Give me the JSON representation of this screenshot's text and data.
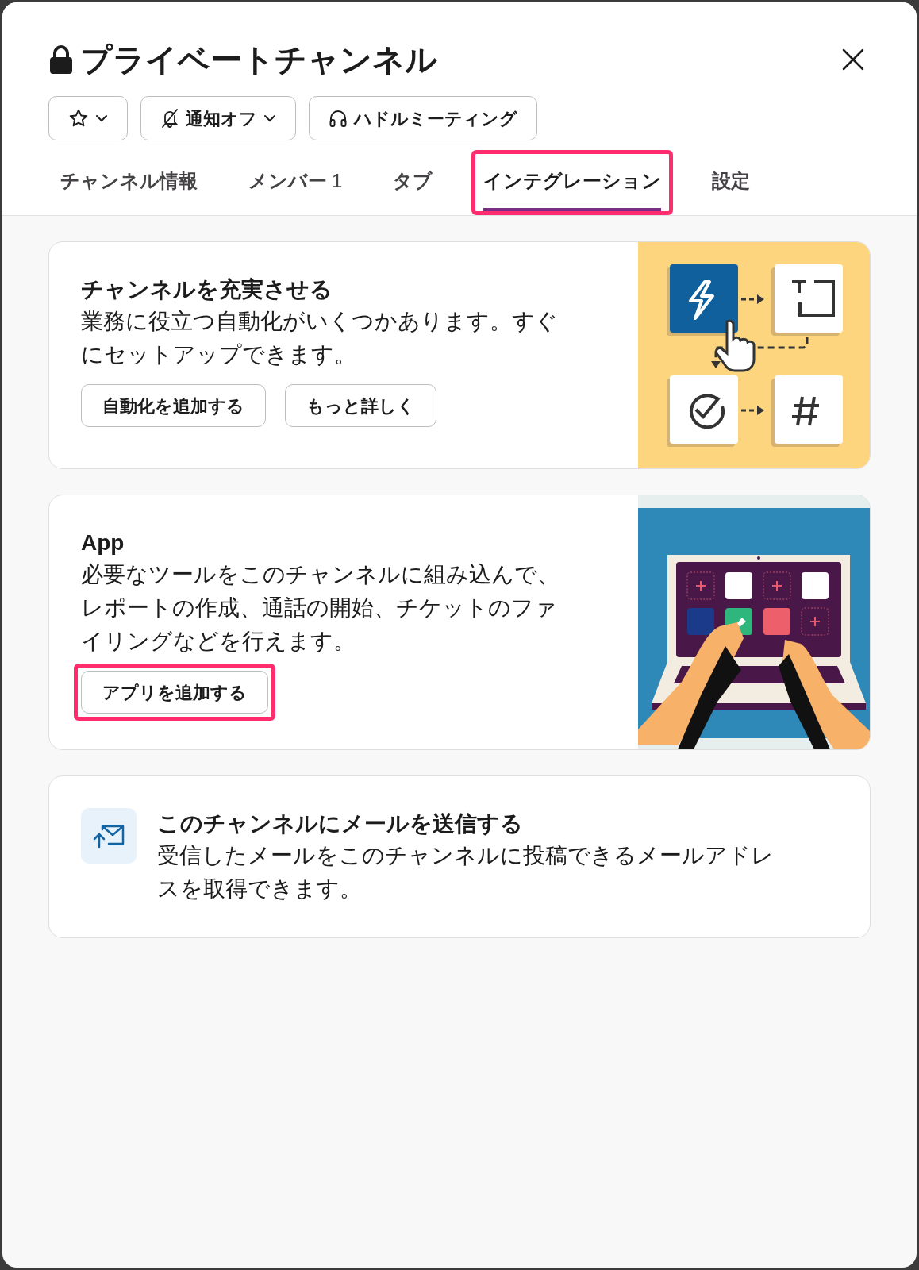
{
  "dialog": {
    "title": "プライベートチャンネル",
    "private": true
  },
  "actions": [
    {
      "kind": "star",
      "caret": true
    },
    {
      "kind": "mute",
      "label": "通知オフ",
      "caret": true
    },
    {
      "kind": "huddle",
      "label": "ハドルミーティング",
      "caret": false
    }
  ],
  "tabs": [
    {
      "label": "チャンネル情報",
      "selected": false,
      "highlighted": false
    },
    {
      "label": "メンバー",
      "count": "1",
      "selected": false,
      "highlighted": false
    },
    {
      "label": "タブ",
      "selected": false,
      "highlighted": false
    },
    {
      "label": "インテグレーション",
      "selected": true,
      "highlighted": true
    },
    {
      "label": "設定",
      "selected": false,
      "highlighted": false
    }
  ],
  "cards": [
    {
      "kind": "workflow",
      "title": "チャンネルを充実させる",
      "description": "業務に役立つ自動化がいくつかあります。すぐにセットアップできます。",
      "buttons": [
        {
          "label": "自動化を追加する",
          "highlighted": false
        },
        {
          "label": "もっと詳しく",
          "highlighted": false
        }
      ]
    },
    {
      "kind": "apps",
      "title": "App",
      "description": "必要なツールをこのチャンネルに組み込んで、レポートの作成、通話の開始、チケットのファイリングなどを行えます。",
      "buttons": [
        {
          "label": "アプリを追加する",
          "highlighted": true
        }
      ]
    },
    {
      "kind": "email",
      "title": "このチャンネルにメールを送信する",
      "description": "受信したメールをこのチャンネルに投稿できるメールアドレスを取得できます。"
    }
  ]
}
